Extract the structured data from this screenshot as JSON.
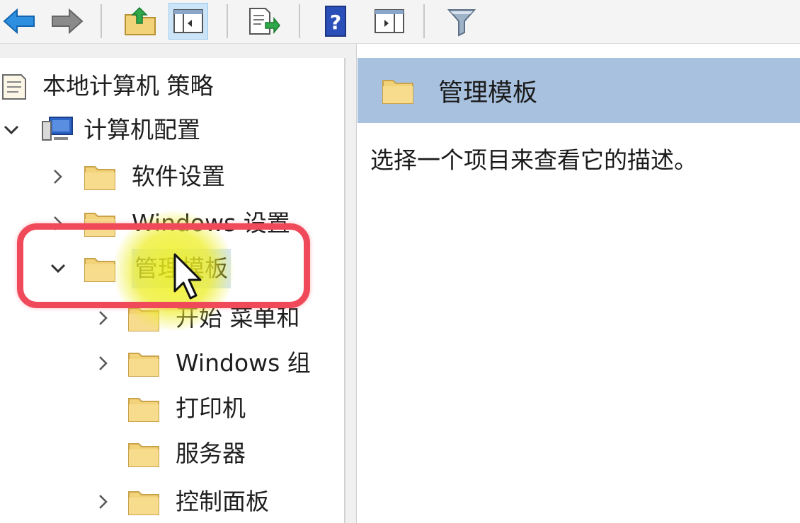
{
  "toolbar": {
    "buttons": [
      {
        "name": "back",
        "icon": "arrow-left-icon"
      },
      {
        "name": "forward",
        "icon": "arrow-right-icon"
      },
      {
        "name": "up-folder",
        "icon": "folder-up-icon"
      },
      {
        "name": "show-hide-tree",
        "icon": "console-tree-icon"
      },
      {
        "name": "export-list",
        "icon": "export-list-icon"
      },
      {
        "name": "help",
        "icon": "help-icon",
        "glyph": "?"
      },
      {
        "name": "show-hide-action",
        "icon": "action-pane-icon"
      },
      {
        "name": "filter",
        "icon": "filter-icon"
      }
    ]
  },
  "tree": {
    "root": "本地计算机 策略",
    "computer_config": "计算机配置",
    "software_settings": "软件设置",
    "windows_settings": "Windows 设置",
    "admin_templates": "管理模板",
    "start_menu": "开始 菜单和",
    "windows_components": "Windows 组",
    "printers": "打印机",
    "servers": "服务器",
    "control_panel": "控制面板"
  },
  "details": {
    "title": "管理模板",
    "description": "选择一个项目来查看它的描述。"
  },
  "colors": {
    "header_bg": "#a8c1de",
    "selection": "#d5e6f6",
    "highlight_ring": "#f04a5a",
    "cursor_glow": "#eeee28",
    "folder": "#f2d37a"
  }
}
